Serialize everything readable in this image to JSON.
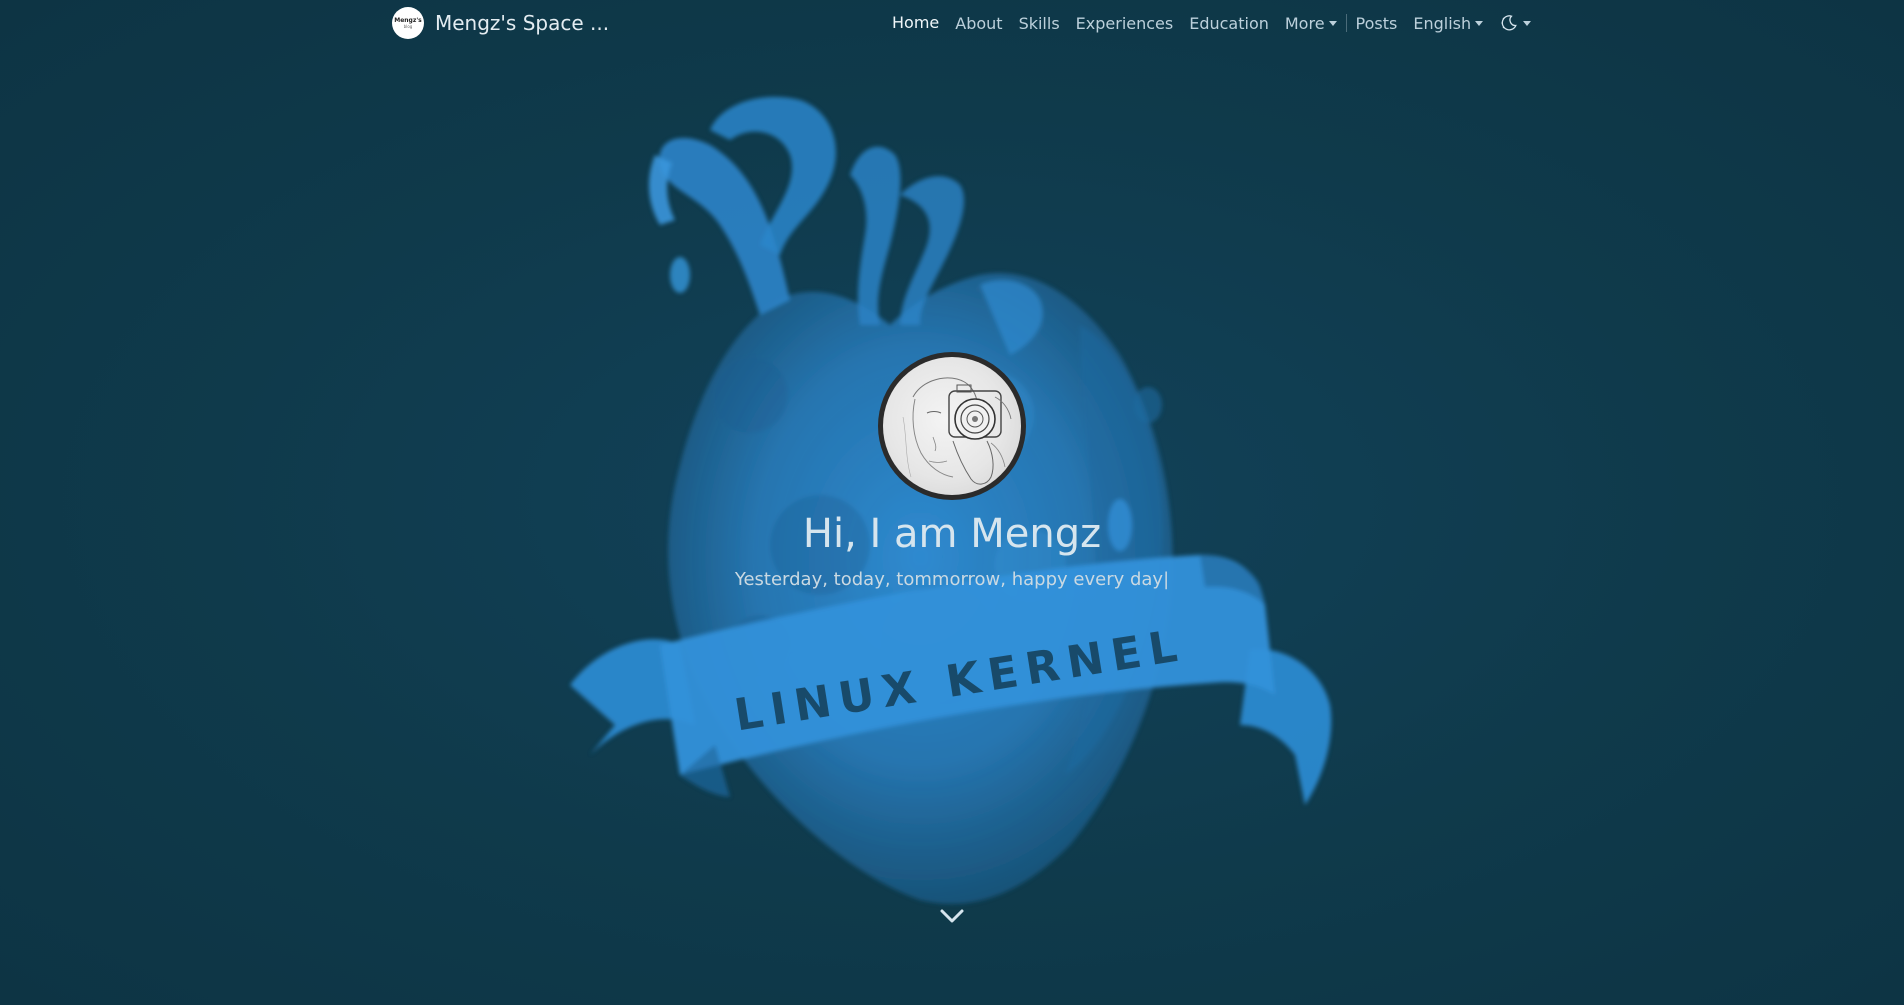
{
  "brand": {
    "title": "Mengz's Space ...",
    "logo_text": "Mengz's",
    "logo_sub": "blog"
  },
  "nav": {
    "items": [
      {
        "label": "Home",
        "active": true
      },
      {
        "label": "About"
      },
      {
        "label": "Skills"
      },
      {
        "label": "Experiences"
      },
      {
        "label": "Education"
      },
      {
        "label": "More",
        "dropdown": true
      },
      {
        "label": "Posts"
      },
      {
        "label": "English",
        "dropdown": true
      }
    ],
    "theme_icon": "theme-toggle-icon"
  },
  "hero": {
    "title": "Hi, I am Mengz",
    "subtitle": "Yesterday, today, tommorrow, happy every day|",
    "banner_text": "LINUX KERNEL"
  },
  "colors": {
    "background": "#0f3a4b",
    "art_blue": "#2e86c8",
    "text": "#d6e5ee"
  },
  "icons": {
    "scroll": "chevron-down-icon"
  }
}
